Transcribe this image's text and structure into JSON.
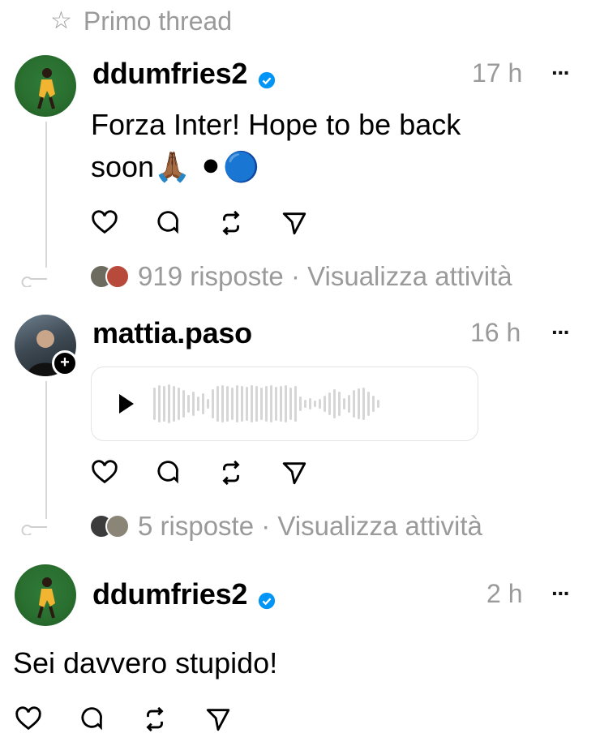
{
  "header": {
    "star_icon": "star-outline-icon",
    "label": "Primo thread"
  },
  "posts": [
    {
      "username": "ddumfries2",
      "verified": true,
      "time": "17 h",
      "more": "···",
      "text_line1": "Forza Inter! Hope to be back",
      "text_line2": "soon🙏🏾 ⚫🔵",
      "replies": "919 risposte · Visualizza attività"
    },
    {
      "username": "mattia.paso",
      "verified": false,
      "time": "16 h",
      "more": "···",
      "audio": "voice-message",
      "replies": "5 risposte · Visualizza attività"
    },
    {
      "username": "ddumfries2",
      "verified": true,
      "time": "2 h",
      "more": "···",
      "text": "Sei davvero stupido!"
    }
  ],
  "colors": {
    "muted": "#9a9a9a",
    "verified_blue": "#0095f6",
    "line": "#d8d8d8"
  }
}
